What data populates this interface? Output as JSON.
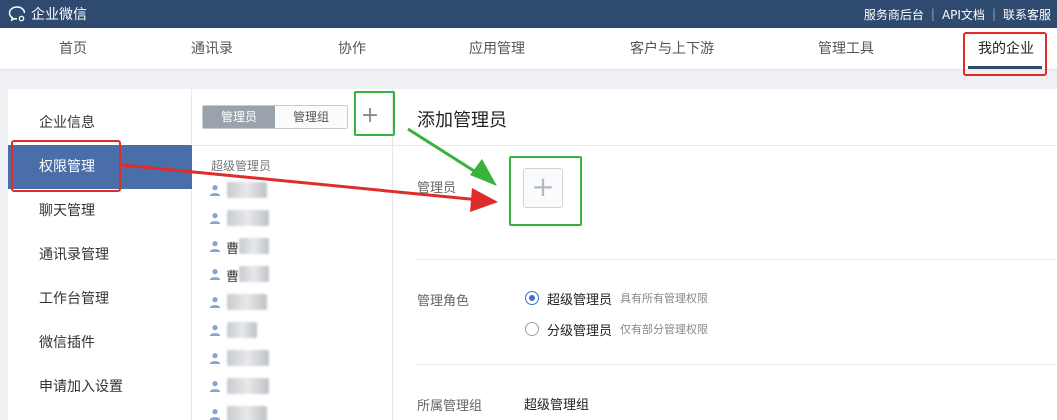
{
  "app": {
    "logo_text": "企业微信"
  },
  "toplinks": [
    "服务商后台",
    "API文档",
    "联系客服"
  ],
  "nav": {
    "items": [
      "首页",
      "通讯录",
      "协作",
      "应用管理",
      "客户与上下游",
      "管理工具",
      "我的企业"
    ],
    "active": "我的企业"
  },
  "sidebar": {
    "items": [
      "企业信息",
      "权限管理",
      "聊天管理",
      "通讯录管理",
      "工作台管理",
      "微信插件",
      "申请加入设置"
    ],
    "active": "权限管理"
  },
  "admin_list": {
    "tabs": [
      "管理员",
      "管理组"
    ],
    "active_tab": "管理员",
    "add_symbol": "+",
    "section_label": "超级管理员",
    "visible_chars": [
      "曹",
      "曹"
    ]
  },
  "form": {
    "title": "添加管理员",
    "admin_label": "管理员",
    "add_symbol": "+",
    "role_label": "管理角色",
    "roles": [
      {
        "name": "超级管理员",
        "desc": "具有所有管理权限",
        "checked": true
      },
      {
        "name": "分级管理员",
        "desc": "仅有部分管理权限",
        "checked": false
      }
    ],
    "group_label": "所属管理组",
    "group_value": "超级管理组"
  },
  "colors": {
    "topbar": "#2f4a6f",
    "sidebar_active": "#4a6ea8",
    "annotation_red": "#e02b2b",
    "annotation_green": "#38b23a"
  }
}
